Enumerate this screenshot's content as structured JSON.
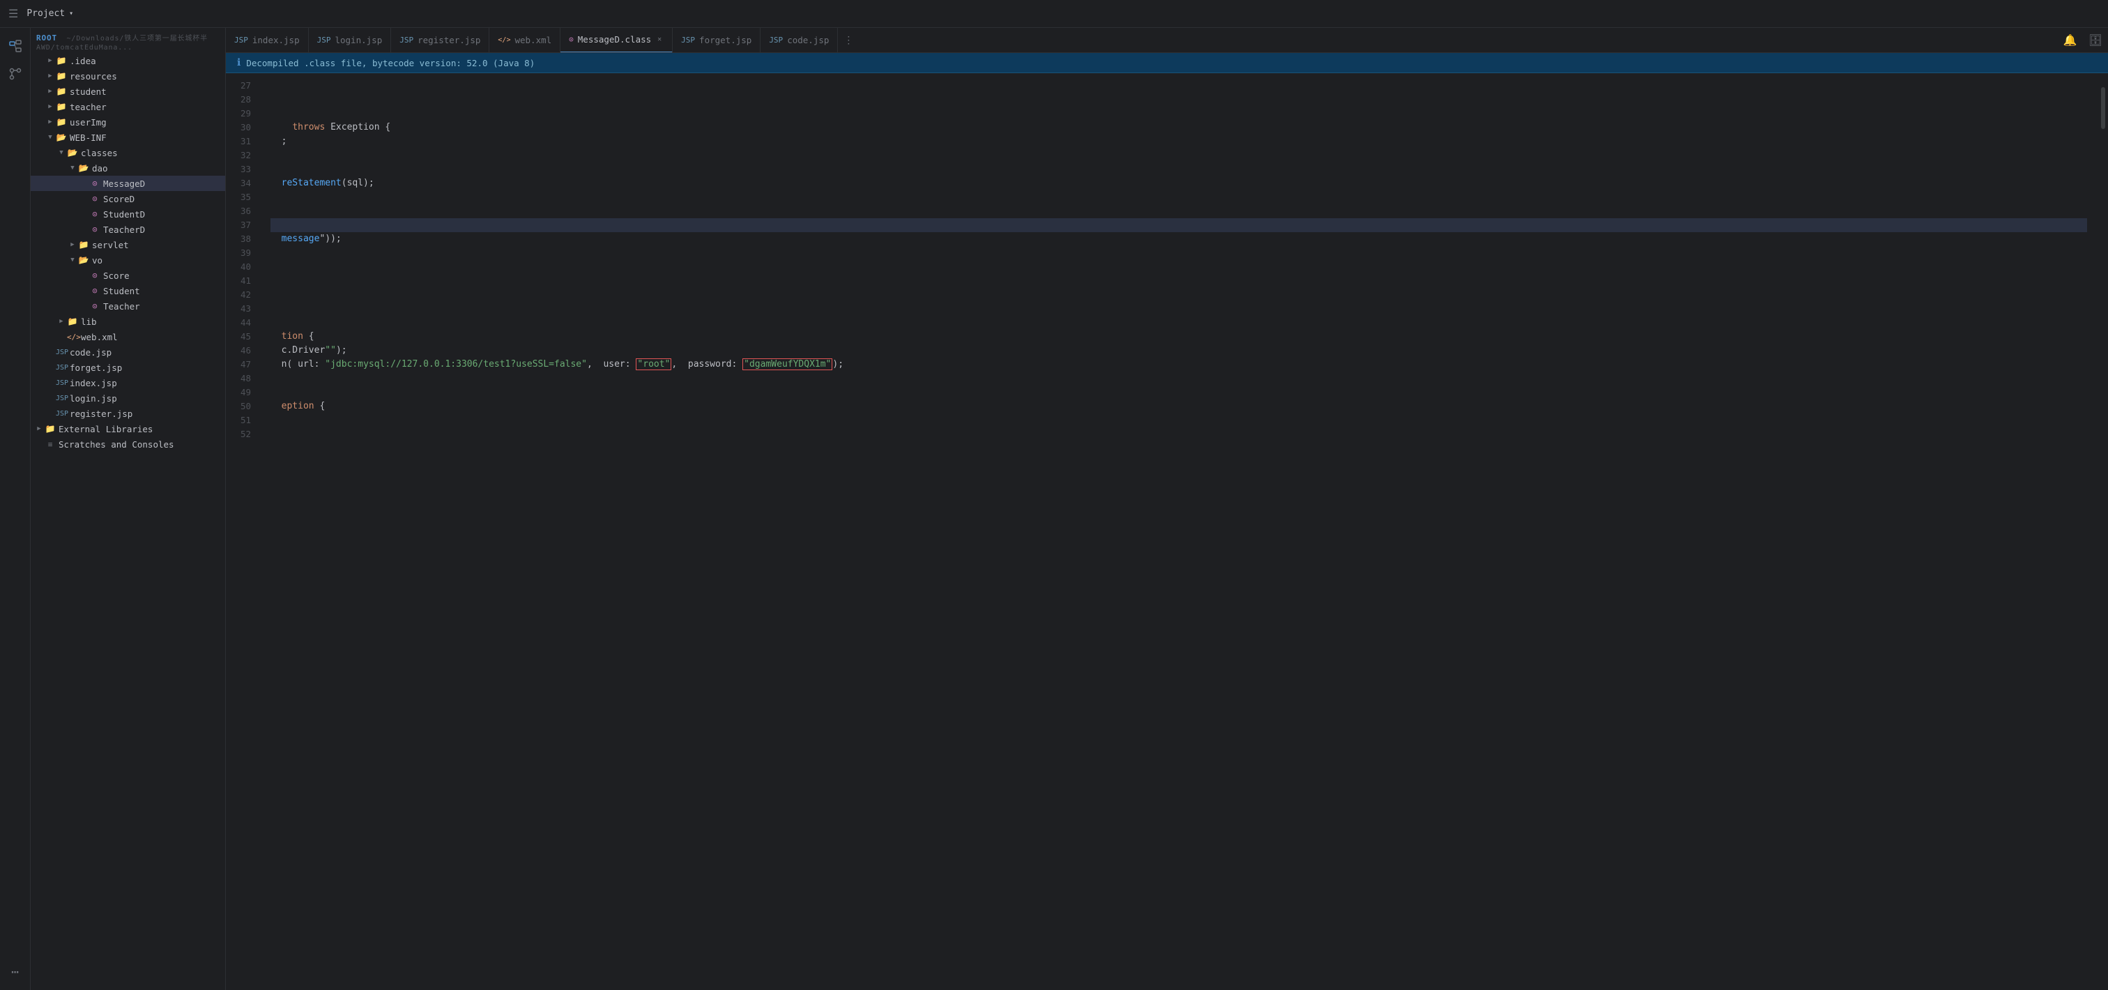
{
  "titleBar": {
    "projectLabel": "Project",
    "chevron": "▾"
  },
  "activityBar": {
    "icons": [
      {
        "name": "folder-tree-icon",
        "symbol": "🗂",
        "active": true
      },
      {
        "name": "git-icon",
        "symbol": "⎇",
        "active": false
      },
      {
        "name": "more-icon",
        "symbol": "⋯",
        "active": false
      }
    ]
  },
  "sidebar": {
    "rootLabel": "ROOT",
    "rootPath": "~/Downloads/铁人三项第一届长城杯半AWD/tomcatEduMana...",
    "tree": [
      {
        "id": "idea",
        "label": ".idea",
        "type": "folder",
        "indent": 1,
        "expanded": false
      },
      {
        "id": "resources",
        "label": "resources",
        "type": "folder",
        "indent": 1,
        "expanded": false
      },
      {
        "id": "student",
        "label": "student",
        "type": "folder",
        "indent": 1,
        "expanded": false
      },
      {
        "id": "teacher",
        "label": "teacher",
        "type": "folder",
        "indent": 1,
        "expanded": false
      },
      {
        "id": "userImg",
        "label": "userImg",
        "type": "folder",
        "indent": 1,
        "expanded": false
      },
      {
        "id": "webinf",
        "label": "WEB-INF",
        "type": "folder",
        "indent": 1,
        "expanded": true
      },
      {
        "id": "classes",
        "label": "classes",
        "type": "folder",
        "indent": 2,
        "expanded": true
      },
      {
        "id": "dao",
        "label": "dao",
        "type": "folder",
        "indent": 3,
        "expanded": true
      },
      {
        "id": "MessageD",
        "label": "MessageD",
        "type": "class",
        "indent": 4,
        "selected": true
      },
      {
        "id": "ScoreD",
        "label": "ScoreD",
        "type": "class",
        "indent": 4
      },
      {
        "id": "StudentD",
        "label": "StudentD",
        "type": "class",
        "indent": 4
      },
      {
        "id": "TeacherD",
        "label": "TeacherD",
        "type": "class",
        "indent": 4
      },
      {
        "id": "servlet",
        "label": "servlet",
        "type": "folder",
        "indent": 3,
        "expanded": false
      },
      {
        "id": "vo",
        "label": "vo",
        "type": "folder",
        "indent": 3,
        "expanded": true
      },
      {
        "id": "Score",
        "label": "Score",
        "type": "class",
        "indent": 4
      },
      {
        "id": "Student",
        "label": "Student",
        "type": "class",
        "indent": 4
      },
      {
        "id": "Teacher",
        "label": "Teacher",
        "type": "class",
        "indent": 4
      },
      {
        "id": "lib",
        "label": "lib",
        "type": "folder",
        "indent": 2,
        "expanded": false
      },
      {
        "id": "webxml",
        "label": "web.xml",
        "type": "xml",
        "indent": 2
      },
      {
        "id": "codejsp",
        "label": "code.jsp",
        "type": "jsp",
        "indent": 1
      },
      {
        "id": "forgetjsp",
        "label": "forget.jsp",
        "type": "jsp",
        "indent": 1
      },
      {
        "id": "indexjsp",
        "label": "index.jsp",
        "type": "jsp",
        "indent": 1
      },
      {
        "id": "loginjsp",
        "label": "login.jsp",
        "type": "jsp",
        "indent": 1
      },
      {
        "id": "registerjsp",
        "label": "register.jsp",
        "type": "jsp",
        "indent": 1
      },
      {
        "id": "extlibs",
        "label": "External Libraries",
        "type": "folder",
        "indent": 0,
        "expanded": false
      },
      {
        "id": "scratches",
        "label": "Scratches and Consoles",
        "type": "scratches",
        "indent": 0
      }
    ]
  },
  "tabs": [
    {
      "id": "indexjsp",
      "label": "index.jsp",
      "type": "jsp",
      "active": false
    },
    {
      "id": "loginjsp",
      "label": "login.jsp",
      "type": "jsp",
      "active": false
    },
    {
      "id": "registerjsp",
      "label": "register.jsp",
      "type": "jsp",
      "active": false
    },
    {
      "id": "webxml",
      "label": "web.xml",
      "type": "xml",
      "active": false
    },
    {
      "id": "MessageD",
      "label": "MessageD.class",
      "type": "class",
      "active": true,
      "closeable": true
    },
    {
      "id": "forgetjsp",
      "label": "forget.jsp",
      "type": "jsp",
      "active": false
    },
    {
      "id": "codejsp",
      "label": "code.jsp",
      "type": "jsp",
      "active": false
    }
  ],
  "banner": {
    "text": "Decompiled .class file, bytecode version: 52.0 (Java 8)"
  },
  "editor": {
    "lines": [
      {
        "num": 27,
        "content": ""
      },
      {
        "num": 28,
        "content": ""
      },
      {
        "num": 29,
        "content": ""
      },
      {
        "num": 30,
        "content": "    throws Exception {",
        "type": "code"
      },
      {
        "num": 31,
        "content": "  ;",
        "type": "code"
      },
      {
        "num": 32,
        "content": ""
      },
      {
        "num": 33,
        "content": ""
      },
      {
        "num": 34,
        "content": "  reStatement(sql);",
        "type": "code"
      },
      {
        "num": 35,
        "content": ""
      },
      {
        "num": 36,
        "content": ""
      },
      {
        "num": 37,
        "content": "",
        "highlighted": true
      },
      {
        "num": 38,
        "content": "  message\"));",
        "type": "code"
      },
      {
        "num": 39,
        "content": ""
      },
      {
        "num": 40,
        "content": ""
      },
      {
        "num": 41,
        "content": ""
      },
      {
        "num": 42,
        "content": ""
      },
      {
        "num": 43,
        "content": ""
      },
      {
        "num": 44,
        "content": ""
      },
      {
        "num": 45,
        "content": "  tion {",
        "type": "code"
      },
      {
        "num": 46,
        "content": "  c.Driver\");",
        "type": "code"
      },
      {
        "num": 47,
        "content": "  n( url: \"jdbc:mysql://127.0.0.1:3306/test1?useSSL=false\",  user: \"root\",  password: \"dgamWeufYDQX1m\");",
        "type": "code",
        "special": true
      },
      {
        "num": 48,
        "content": ""
      },
      {
        "num": 49,
        "content": ""
      },
      {
        "num": 50,
        "content": "  eption {",
        "type": "code"
      },
      {
        "num": 51,
        "content": ""
      },
      {
        "num": 52,
        "content": ""
      }
    ]
  }
}
